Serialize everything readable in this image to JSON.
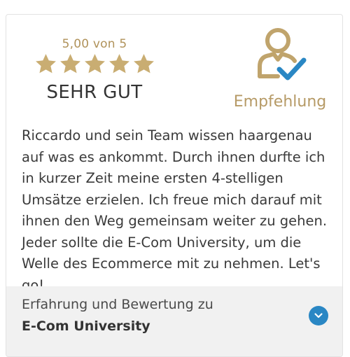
{
  "rating": {
    "score_text": "5,00 von 5",
    "stars": 5,
    "max_stars": 5,
    "verdict": "SEHR GUT"
  },
  "badge": {
    "icon": "user-check-icon",
    "label": "Empfehlung"
  },
  "review": {
    "text": "Riccardo und sein Team wissen haargenau auf was es ankommt. Durch ihnen durfte ich in kurzer Zeit meine ersten 4-stelligen Umsätze erzielen. Ich freue mich darauf mit ihnen den Weg gemeinsam weiter zu gehen. Jeder sollte die E-Com University, um die Welle des Ecommerce mit zu nehmen. Let's go!"
  },
  "footer": {
    "label": "Erfahrung und Bewertung zu",
    "company": "E-Com University",
    "expand_icon": "chevron-down-icon"
  },
  "colors": {
    "gold": "#c9ad72",
    "badge_gold": "#b69a66",
    "check_blue": "#2a87c4",
    "footer_bg": "#f1f1f1"
  }
}
